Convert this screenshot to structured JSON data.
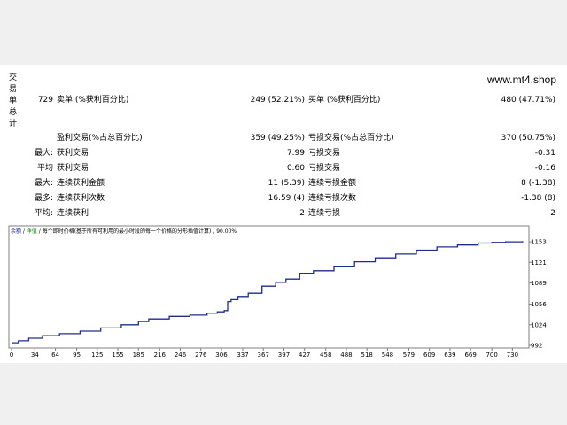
{
  "site": "www.mt4.shop",
  "vertical_label": [
    "交",
    "易",
    "单",
    "总",
    "计"
  ],
  "stats": {
    "total": "729",
    "sell_label": "卖单 (%获利百分比)",
    "sell_value": "249 (52.21%)",
    "buy_label": "买单 (%获利百分比)",
    "buy_value": "480 (47.71%)",
    "profit_trades_label": "盈利交易(%占总百分比)",
    "profit_trades_value": "359 (49.25%)",
    "loss_trades_label": "亏损交易(%占总百分比)",
    "loss_trades_value": "370 (50.75%)",
    "rows": [
      {
        "prefix": "最大:",
        "left_label": "获利交易",
        "left_value": "7.99",
        "right_label": "亏损交易",
        "right_value": "-0.31"
      },
      {
        "prefix": "平均",
        "left_label": "获利交易",
        "left_value": "0.60",
        "right_label": "亏损交易",
        "right_value": "-0.16"
      },
      {
        "prefix": "最大:",
        "left_label": "连续获利金额",
        "left_value": "11 (5.39)",
        "right_label": "连续亏损金额",
        "right_value": "8 (-1.38)"
      },
      {
        "prefix": "最多:",
        "left_label": "连续获利次数",
        "left_value": "16.59 (4)",
        "right_label": "连续亏损次数",
        "right_value": "-1.38 (8)"
      },
      {
        "prefix": "平均:",
        "left_label": "连续获利",
        "left_value": "2",
        "right_label": "连续亏损",
        "right_value": "2"
      }
    ]
  },
  "chart_legend": {
    "balance": "余额",
    "sep1": " / ",
    "equity": "净值",
    "sep2": " / ",
    "desc": "每个即时价格(基于所有可利用的最小时段的每一个价格的分形插值计算) / 90.00%"
  },
  "colors": {
    "balance_line": "#1f2d8c",
    "legend_balance": "#1f2d8c",
    "legend_equity": "#1a8a1a"
  },
  "chart_data": {
    "type": "line",
    "title": "",
    "xlabel": "",
    "ylabel": "",
    "x_ticks": [
      "0",
      "34",
      "64",
      "95",
      "125",
      "155",
      "185",
      "216",
      "246",
      "276",
      "306",
      "337",
      "367",
      "397",
      "427",
      "458",
      "488",
      "518",
      "548",
      "579",
      "609",
      "639",
      "669",
      "700",
      "730"
    ],
    "y_ticks": [
      "1153",
      "1121",
      "1089",
      "1056",
      "1024",
      "992"
    ],
    "xlim": [
      0,
      745
    ],
    "ylim": [
      992,
      1160
    ],
    "series": [
      {
        "x": [
          0,
          10,
          25,
          45,
          70,
          100,
          130,
          160,
          185,
          200,
          230,
          260,
          285,
          300,
          310,
          315,
          320,
          330,
          345,
          365,
          385,
          400,
          420,
          440,
          470,
          500,
          530,
          560,
          590,
          620,
          650,
          680,
          700,
          720,
          745
        ],
        "y": [
          996,
          999,
          1003,
          1007,
          1010,
          1014,
          1019,
          1024,
          1029,
          1033,
          1037,
          1039,
          1042,
          1044,
          1046,
          1060,
          1063,
          1068,
          1073,
          1084,
          1090,
          1095,
          1104,
          1108,
          1115,
          1122,
          1128,
          1134,
          1140,
          1145,
          1148,
          1151,
          1152,
          1153,
          1154
        ]
      }
    ]
  }
}
